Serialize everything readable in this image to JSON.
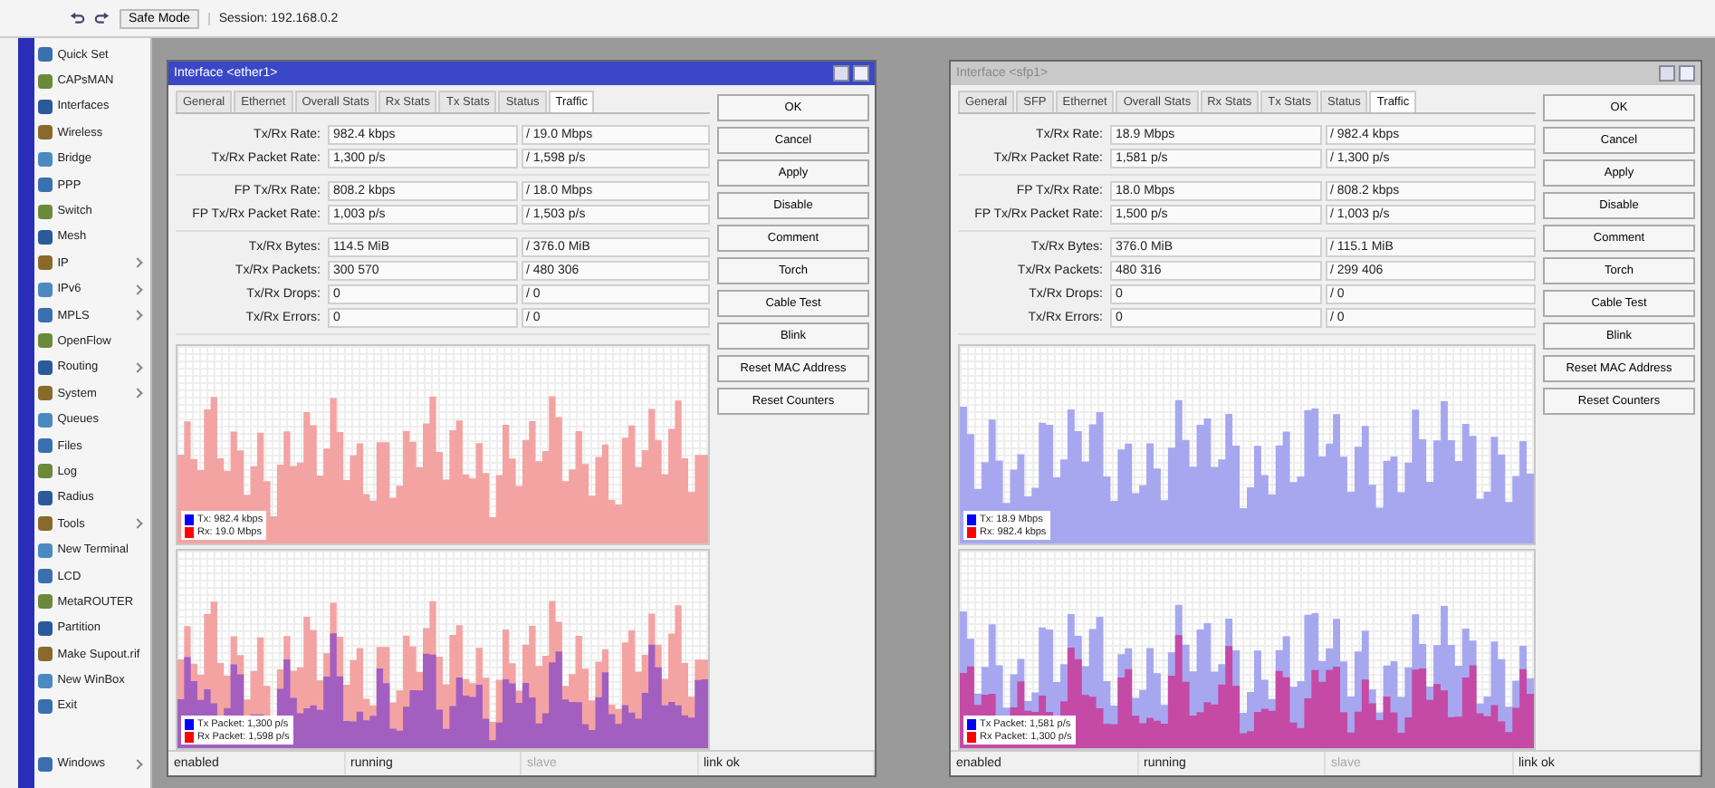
{
  "toolbar": {
    "safe_mode": "Safe Mode",
    "session": "Session: 192.168.0.2"
  },
  "sidebar": {
    "items": [
      {
        "label": "Quick Set",
        "submenu": false
      },
      {
        "label": "CAPsMAN",
        "submenu": false
      },
      {
        "label": "Interfaces",
        "submenu": false
      },
      {
        "label": "Wireless",
        "submenu": false
      },
      {
        "label": "Bridge",
        "submenu": false
      },
      {
        "label": "PPP",
        "submenu": false
      },
      {
        "label": "Switch",
        "submenu": false
      },
      {
        "label": "Mesh",
        "submenu": false
      },
      {
        "label": "IP",
        "submenu": true
      },
      {
        "label": "IPv6",
        "submenu": true
      },
      {
        "label": "MPLS",
        "submenu": true
      },
      {
        "label": "OpenFlow",
        "submenu": false
      },
      {
        "label": "Routing",
        "submenu": true
      },
      {
        "label": "System",
        "submenu": true
      },
      {
        "label": "Queues",
        "submenu": false
      },
      {
        "label": "Files",
        "submenu": false
      },
      {
        "label": "Log",
        "submenu": false
      },
      {
        "label": "Radius",
        "submenu": false
      },
      {
        "label": "Tools",
        "submenu": true
      },
      {
        "label": "New Terminal",
        "submenu": false
      },
      {
        "label": "LCD",
        "submenu": false
      },
      {
        "label": "MetaROUTER",
        "submenu": false
      },
      {
        "label": "Partition",
        "submenu": false
      },
      {
        "label": "Make Supout.rif",
        "submenu": false
      },
      {
        "label": "New WinBox",
        "submenu": false
      },
      {
        "label": "Exit",
        "submenu": false
      }
    ],
    "footer": {
      "label": "Windows",
      "submenu": true
    }
  },
  "windows": [
    {
      "title": "Interface <ether1>",
      "active": true,
      "tabs": [
        {
          "label": "General",
          "selected": false
        },
        {
          "label": "Ethernet",
          "selected": false
        },
        {
          "label": "Overall Stats",
          "selected": false
        },
        {
          "label": "Rx Stats",
          "selected": false
        },
        {
          "label": "Tx Stats",
          "selected": false
        },
        {
          "label": "Status",
          "selected": false
        },
        {
          "label": "Traffic",
          "selected": true
        }
      ],
      "field_groups": [
        [
          {
            "label": "Tx/Rx Rate:",
            "tx": "982.4 kbps",
            "rx": "/ 19.0 Mbps"
          },
          {
            "label": "Tx/Rx Packet Rate:",
            "tx": "1,300 p/s",
            "rx": "/ 1,598 p/s"
          }
        ],
        [
          {
            "label": "FP Tx/Rx Rate:",
            "tx": "808.2 kbps",
            "rx": "/ 18.0 Mbps"
          },
          {
            "label": "FP Tx/Rx Packet Rate:",
            "tx": "1,003 p/s",
            "rx": "/ 1,503 p/s"
          }
        ],
        [
          {
            "label": "Tx/Rx Bytes:",
            "tx": "114.5 MiB",
            "rx": "/ 376.0 MiB"
          },
          {
            "label": "Tx/Rx Packets:",
            "tx": "300 570",
            "rx": "/ 480 306"
          },
          {
            "label": "Tx/Rx Drops:",
            "tx": "0",
            "rx": "/ 0"
          },
          {
            "label": "Tx/Rx Errors:",
            "tx": "0",
            "rx": "/ 0"
          }
        ]
      ],
      "graphs": [
        {
          "kind": "picture",
          "legend": [
            {
              "label": "Tx: 982.4 kbps",
              "color": "#0000ff"
            },
            {
              "label": "Rx: 19.0 Mbps",
              "color": "#ff0000"
            }
          ]
        },
        {
          "kind": "picture",
          "legend": [
            {
              "label": "Tx Packet: 1,300 p/s",
              "color": "#0000ff"
            },
            {
              "label": "Rx Packet: 1,598 p/s",
              "color": "#ff0000"
            }
          ]
        }
      ],
      "buttons": [
        "OK",
        "Cancel",
        "Apply",
        "Disable",
        "Comment",
        "Torch",
        "Cable Test",
        "Blink",
        "Reset MAC Address",
        "Reset Counters"
      ],
      "status_bar": [
        {
          "text": "enabled",
          "disabled": false
        },
        {
          "text": "running",
          "disabled": false
        },
        {
          "text": "slave",
          "disabled": true
        },
        {
          "text": "link ok",
          "disabled": false
        }
      ]
    },
    {
      "title": "Interface <sfp1>",
      "active": false,
      "tabs": [
        {
          "label": "General",
          "selected": false
        },
        {
          "label": "SFP",
          "selected": false
        },
        {
          "label": "Ethernet",
          "selected": false
        },
        {
          "label": "Overall Stats",
          "selected": false
        },
        {
          "label": "Rx Stats",
          "selected": false
        },
        {
          "label": "Tx Stats",
          "selected": false
        },
        {
          "label": "Status",
          "selected": false
        },
        {
          "label": "Traffic",
          "selected": true
        }
      ],
      "field_groups": [
        [
          {
            "label": "Tx/Rx Rate:",
            "tx": "18.9 Mbps",
            "rx": "/ 982.4 kbps"
          },
          {
            "label": "Tx/Rx Packet Rate:",
            "tx": "1,581 p/s",
            "rx": "/ 1,300 p/s"
          }
        ],
        [
          {
            "label": "FP Tx/Rx Rate:",
            "tx": "18.0 Mbps",
            "rx": "/ 808.2 kbps"
          },
          {
            "label": "FP Tx/Rx Packet Rate:",
            "tx": "1,500 p/s",
            "rx": "/ 1,003 p/s"
          }
        ],
        [
          {
            "label": "Tx/Rx Bytes:",
            "tx": "376.0 MiB",
            "rx": "/ 115.1 MiB"
          },
          {
            "label": "Tx/Rx Packets:",
            "tx": "480 316",
            "rx": "/ 299 406"
          },
          {
            "label": "Tx/Rx Drops:",
            "tx": "0",
            "rx": "/ 0"
          },
          {
            "label": "Tx/Rx Errors:",
            "tx": "0",
            "rx": "/ 0"
          }
        ]
      ],
      "graphs": [
        {
          "kind": "picture",
          "legend": [
            {
              "label": "Tx: 18.9 Mbps",
              "color": "#0000ff"
            },
            {
              "label": "Rx: 982.4 kbps",
              "color": "#ff0000"
            }
          ]
        },
        {
          "kind": "picture",
          "legend": [
            {
              "label": "Tx Packet: 1,581 p/s",
              "color": "#0000ff"
            },
            {
              "label": "Rx Packet: 1,300 p/s",
              "color": "#ff0000"
            }
          ]
        }
      ],
      "buttons": [
        "OK",
        "Cancel",
        "Apply",
        "Disable",
        "Comment",
        "Torch",
        "Cable Test",
        "Blink",
        "Reset MAC Address",
        "Reset Counters"
      ],
      "status_bar": [
        {
          "text": "enabled",
          "disabled": false
        },
        {
          "text": "running",
          "disabled": false
        },
        {
          "text": "slave",
          "disabled": true
        },
        {
          "text": "link ok",
          "disabled": false
        }
      ]
    }
  ]
}
